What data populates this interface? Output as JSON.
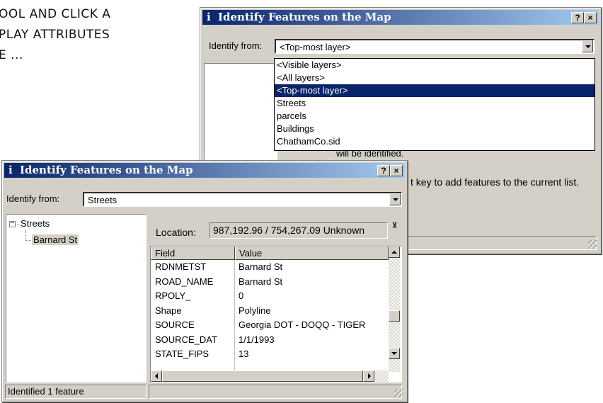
{
  "background_text": {
    "line1": "OOL AND CLICK A",
    "line2": "PLAY ATTRIBUTES",
    "line3": "E ..."
  },
  "back_window": {
    "title": "Identify Features on the Map",
    "identify_from_label": "Identify from:",
    "identify_from_value": "<Top-most layer>",
    "dropdown_options": [
      "<Visible layers>",
      "<All layers>",
      "<Top-most layer>",
      "Streets",
      "parcels",
      "Buildings",
      "ChathamCo.sid"
    ],
    "selected_option_index": 2,
    "partial_text_1": "will be identified.",
    "partial_text_2": "t key to add features to the current list."
  },
  "front_window": {
    "title": "Identify Features on the Map",
    "identify_from_label": "Identify from:",
    "identify_from_value": "Streets",
    "tree": {
      "root": "Streets",
      "child": "Barnard St"
    },
    "location_label": "Location:",
    "location_value": "987,192.96 / 754,267.09 Unknown",
    "grid_headers": [
      "Field",
      "Value"
    ],
    "grid_rows": [
      [
        "RDNMETST",
        "Barnard St"
      ],
      [
        "ROAD_NAME",
        "Barnard St"
      ],
      [
        "RPOLY_",
        "0"
      ],
      [
        "Shape",
        "Polyline"
      ],
      [
        "SOURCE",
        "Georgia DOT - DOQQ - TIGER"
      ],
      [
        "SOURCE_DAT",
        "1/1/1993"
      ],
      [
        "STATE_FIPS",
        "13"
      ]
    ],
    "status_text": "Identified 1 feature"
  },
  "icons": {
    "title_icon": "info-icon",
    "help": "?",
    "close": "×",
    "collapse": "−"
  },
  "colors": {
    "titlebar_start": "#0a246a",
    "titlebar_end": "#a6caf0",
    "selection": "#0a246a",
    "window_face": "#d4d0c8"
  }
}
